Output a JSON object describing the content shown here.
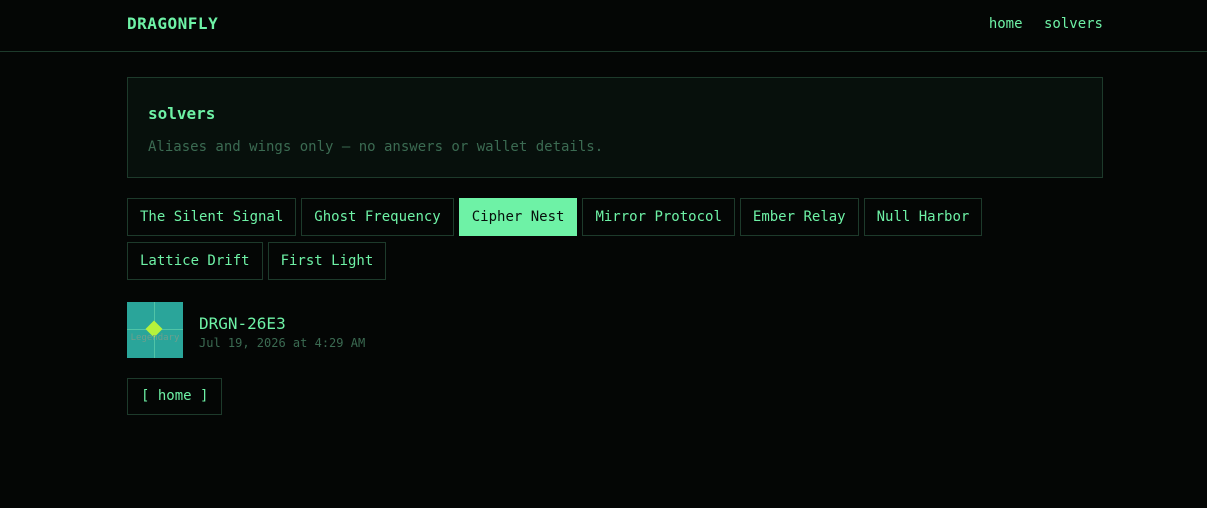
{
  "header": {
    "brand": "DRAGONFLY",
    "nav": [
      {
        "label": "home"
      },
      {
        "label": "solvers"
      }
    ]
  },
  "panel": {
    "title": "solvers",
    "subtitle": "Aliases and wings only — no answers or wallet details."
  },
  "tabs": [
    {
      "label": "The Silent Signal",
      "active": false
    },
    {
      "label": "Ghost Frequency",
      "active": false
    },
    {
      "label": "Cipher Nest",
      "active": true
    },
    {
      "label": "Mirror Protocol",
      "active": false
    },
    {
      "label": "Ember Relay",
      "active": false
    },
    {
      "label": "Null Harbor",
      "active": false
    },
    {
      "label": "Lattice Drift",
      "active": false
    },
    {
      "label": "First Light",
      "active": false
    }
  ],
  "solver": {
    "avatar_tier": "Legendary",
    "name": "DRGN-26E3",
    "timestamp": "Jul 19, 2026 at 4:29 AM"
  },
  "footer": {
    "home_button": "[ home ]"
  },
  "colors": {
    "background": "#040605",
    "accent": "#6ef2a6",
    "border": "#1d3a2b",
    "muted": "#3b6b52",
    "avatar_bg": "#2aa59a",
    "avatar_diamond": "#b6f23c"
  }
}
